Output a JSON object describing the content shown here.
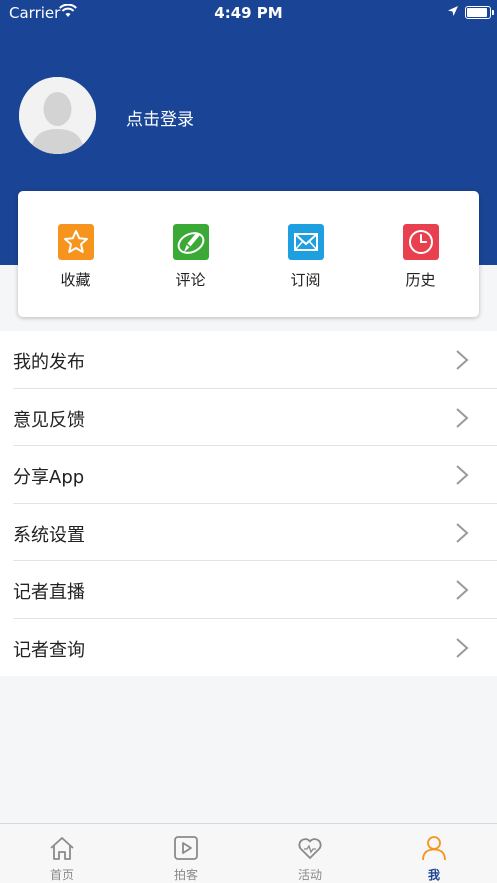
{
  "status_bar": {
    "carrier": "Carrier",
    "time": "4:49 PM"
  },
  "profile": {
    "login_label": "点击登录"
  },
  "shortcuts": [
    {
      "label": "收藏",
      "icon": "star-icon",
      "color": "#f7941d"
    },
    {
      "label": "评论",
      "icon": "comment-pen-icon",
      "color": "#3aa935"
    },
    {
      "label": "订阅",
      "icon": "mail-icon",
      "color": "#1ea0e0"
    },
    {
      "label": "历史",
      "icon": "clock-icon",
      "color": "#e8404f"
    }
  ],
  "menu": {
    "items": [
      "我的发布",
      "意见反馈",
      "分享App",
      "系统设置",
      "记者直播",
      "记者查询"
    ]
  },
  "tabbar": {
    "tabs": [
      {
        "label": "首页",
        "icon": "home-icon"
      },
      {
        "label": "拍客",
        "icon": "video-play-icon"
      },
      {
        "label": "活动",
        "icon": "heart-icon"
      },
      {
        "label": "我",
        "icon": "user-icon",
        "active": true
      }
    ],
    "active_color": "#1a4596"
  },
  "colors": {
    "header": "#1a4596",
    "accent_orange": "#f7941d"
  }
}
